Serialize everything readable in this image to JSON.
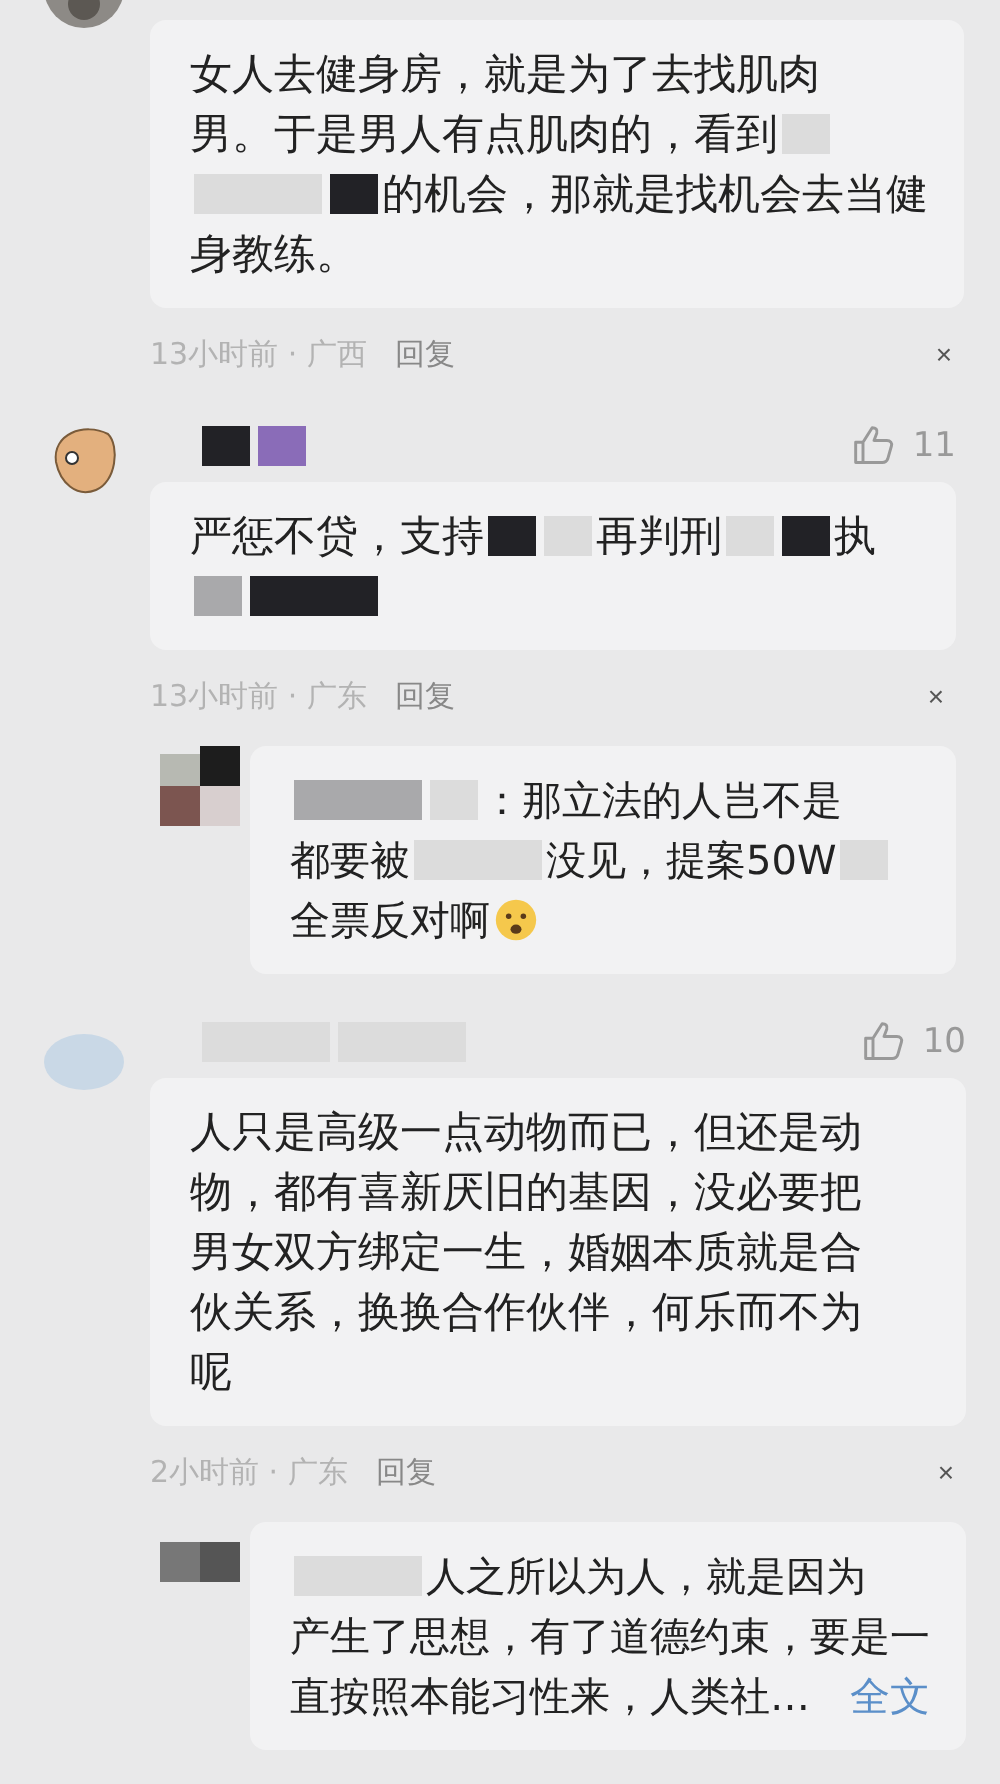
{
  "comments": [
    {
      "avatar": {
        "kind": "photo"
      },
      "bubble": {
        "lines": [
          [
            {
              "kind": "text",
              "text": "女人去健身房，就是为了去找肌肉"
            }
          ],
          [
            {
              "kind": "text",
              "text": "男。于是男人有点肌肉的，看到"
            },
            {
              "kind": "blot",
              "color": "#dcdcdc"
            }
          ],
          [
            {
              "kind": "bar",
              "color": "#dcdcdc"
            },
            {
              "kind": "blot",
              "color": "#222226"
            },
            {
              "kind": "text",
              "text": "的机会，那就是找机会去当健"
            }
          ],
          [
            {
              "kind": "text",
              "text": "身教练。"
            }
          ]
        ]
      },
      "meta": "13小时前 · 广西",
      "reply_label": "回复",
      "close": "×"
    },
    {
      "avatar": {
        "kind": "cartoon"
      },
      "name": [
        {
          "kind": "blot",
          "color": "#222226"
        },
        {
          "kind": "blot",
          "color": "#8a6cb8"
        }
      ],
      "likes": "11",
      "bubble": {
        "lines": [
          [
            {
              "kind": "text",
              "text": "严惩不贷，支持"
            },
            {
              "kind": "blot",
              "color": "#222226"
            },
            {
              "kind": "blot",
              "color": "#dcdcdc"
            },
            {
              "kind": "text",
              "text": "再判刑"
            },
            {
              "kind": "blot",
              "color": "#dcdcdc"
            },
            {
              "kind": "blot",
              "color": "#222226"
            },
            {
              "kind": "text",
              "text": "执"
            }
          ],
          [
            {
              "kind": "blot",
              "color": "#a9a9ab"
            },
            {
              "kind": "bar",
              "color": "#222226"
            }
          ]
        ]
      },
      "meta": "13小时前 · 广东",
      "reply_label": "回复",
      "close": "×",
      "reply": {
        "avatar": {
          "kind": "mosaic"
        },
        "lines": [
          [
            {
              "kind": "bar",
              "color": "#a9a9ab"
            },
            {
              "kind": "blot",
              "color": "#dcdcdc"
            },
            {
              "kind": "text",
              "text": "：那立法的人岂不是"
            }
          ],
          [
            {
              "kind": "text",
              "text": "都要被"
            },
            {
              "kind": "bar",
              "color": "#dcdcdc"
            },
            {
              "kind": "text",
              "text": "没见，提案50W"
            },
            {
              "kind": "blot",
              "color": "#dcdcdc"
            }
          ],
          [
            {
              "kind": "text",
              "text": "全票反对啊"
            },
            {
              "kind": "emoji"
            }
          ]
        ]
      }
    },
    {
      "avatar": {
        "kind": "blank"
      },
      "name": [
        {
          "kind": "bar",
          "color": "#dcdcdc"
        },
        {
          "kind": "bar",
          "color": "#dcdcdc"
        }
      ],
      "likes": "10",
      "bubble": {
        "lines": [
          [
            {
              "kind": "text",
              "text": "人只是高级一点动物而已，但还是动"
            }
          ],
          [
            {
              "kind": "text",
              "text": "物，都有喜新厌旧的基因，没必要把"
            }
          ],
          [
            {
              "kind": "text",
              "text": "男女双方绑定一生，婚姻本质就是合"
            }
          ],
          [
            {
              "kind": "text",
              "text": "伙关系，换换合作伙伴，何乐而不为"
            }
          ],
          [
            {
              "kind": "text",
              "text": "呢"
            }
          ]
        ]
      },
      "meta": "2小时前 · 广东",
      "reply_label": "回复",
      "close": "×",
      "reply": {
        "avatar": {
          "kind": "mosaic-dark"
        },
        "lines": [
          [
            {
              "kind": "bar",
              "color": "#dcdcdc"
            },
            {
              "kind": "text",
              "text": "人之所以为人，就是因为"
            }
          ],
          [
            {
              "kind": "text",
              "text": "产生了思想，有了道德约束，要是一"
            }
          ],
          [
            {
              "kind": "text",
              "text": "直按照本能习性来，人类社…"
            },
            {
              "kind": "link",
              "text": "全文"
            }
          ]
        ]
      }
    }
  ]
}
